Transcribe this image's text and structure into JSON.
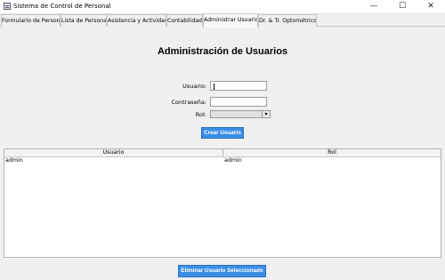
{
  "window": {
    "title": "Sistema de Control de Personal",
    "minimize": "—",
    "maximize": "☐",
    "close": "✕"
  },
  "tabs": [
    {
      "label": "Formulario de Personal"
    },
    {
      "label": "Lista de Personal"
    },
    {
      "label": "Asistencia y Actividad"
    },
    {
      "label": "Contabilidad"
    },
    {
      "label": "Administrar Usuarios",
      "active": true
    },
    {
      "label": "Dr. & Tr. Optométrico"
    }
  ],
  "form": {
    "heading": "Administración de Usuarios",
    "user_label": "Usuario:",
    "user_value": "",
    "password_label": "Contraseña:",
    "password_value": "",
    "role_label": "Rol:",
    "role_value": "",
    "create_button": "Crear Usuario"
  },
  "table": {
    "columns": [
      "Usuario",
      "Rol"
    ],
    "rows": [
      [
        "admin",
        "admin"
      ]
    ]
  },
  "delete_button": "Eliminar Usuario Seleccionado",
  "colors": {
    "accent": "#3c8ee6"
  },
  "icons": {
    "app": "app-window-icon",
    "combo": "chevron-down-icon"
  }
}
